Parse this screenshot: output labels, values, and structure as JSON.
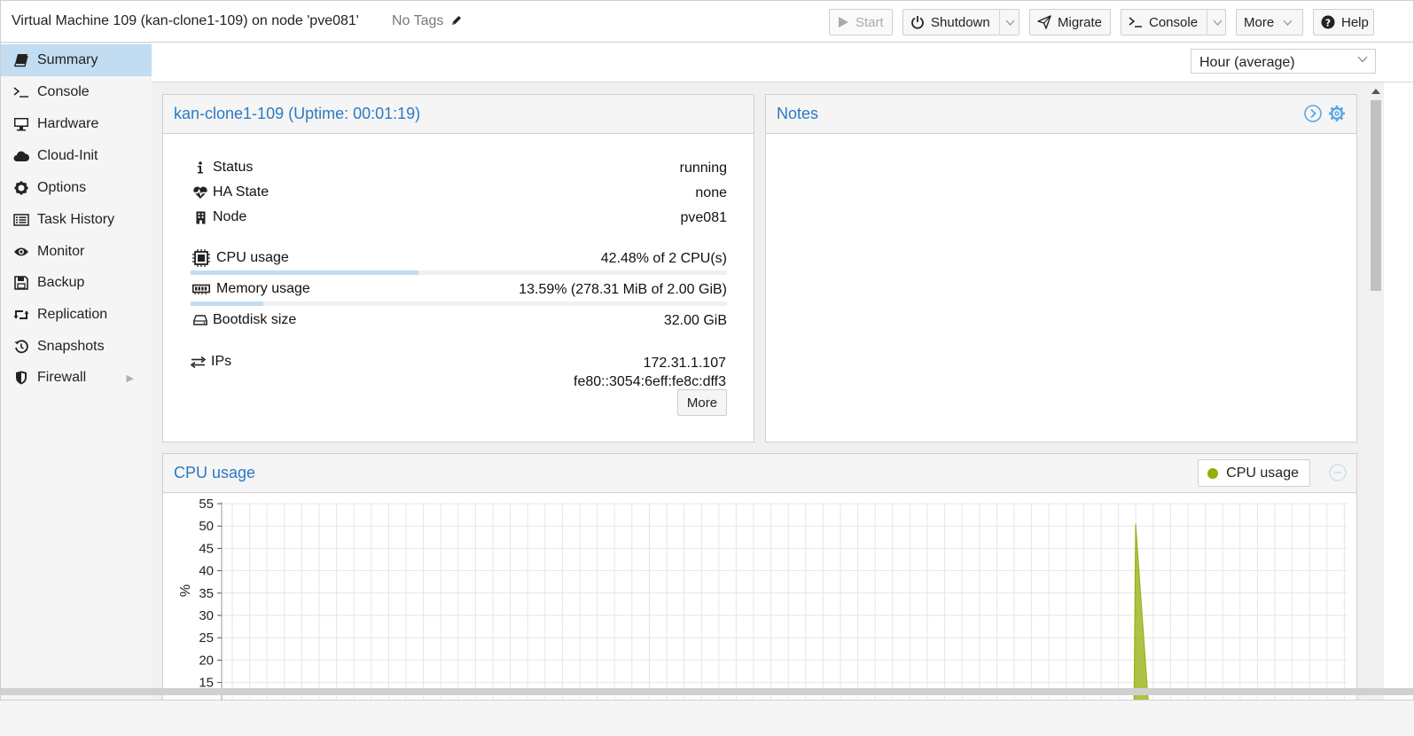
{
  "header": {
    "title": "Virtual Machine 109 (kan-clone1-109) on node 'pve081'",
    "tags": "No Tags",
    "buttons": {
      "start": "Start",
      "shutdown": "Shutdown",
      "migrate": "Migrate",
      "console": "Console",
      "more": "More",
      "help": "Help"
    }
  },
  "sidebar": {
    "items": [
      {
        "label": "Summary",
        "icon": "book-icon"
      },
      {
        "label": "Console",
        "icon": "terminal-icon"
      },
      {
        "label": "Hardware",
        "icon": "desktop-icon"
      },
      {
        "label": "Cloud-Init",
        "icon": "cloud-icon"
      },
      {
        "label": "Options",
        "icon": "gear-icon"
      },
      {
        "label": "Task History",
        "icon": "list-icon"
      },
      {
        "label": "Monitor",
        "icon": "eye-icon"
      },
      {
        "label": "Backup",
        "icon": "floppy-icon"
      },
      {
        "label": "Replication",
        "icon": "retweet-icon"
      },
      {
        "label": "Snapshots",
        "icon": "history-icon"
      },
      {
        "label": "Firewall",
        "icon": "shield-icon"
      }
    ]
  },
  "timeframe": {
    "selected": "Hour (average)"
  },
  "status_panel": {
    "title": "kan-clone1-109 (Uptime: 00:01:19)",
    "status": {
      "label": "Status",
      "value": "running"
    },
    "ha": {
      "label": "HA State",
      "value": "none"
    },
    "node": {
      "label": "Node",
      "value": "pve081"
    },
    "cpu": {
      "label": "CPU usage",
      "value": "42.48% of 2 CPU(s)",
      "fraction": 0.4248
    },
    "memory": {
      "label": "Memory usage",
      "value": "13.59% (278.31 MiB of 2.00 GiB)",
      "fraction": 0.1359
    },
    "bootdisk": {
      "label": "Bootdisk size",
      "value": "32.00 GiB"
    },
    "ips": {
      "label": "IPs",
      "ipv4": "172.31.1.107",
      "ipv6": "fe80::3054:6eff:fe8c:dff3"
    },
    "more_button": "More"
  },
  "notes_panel": {
    "title": "Notes"
  },
  "chart_panel": {
    "title": "CPU usage",
    "legend_label": "CPU usage",
    "ylabel": "%",
    "yticks": [
      "55",
      "50",
      "45",
      "40",
      "35",
      "30",
      "25",
      "20",
      "15"
    ]
  },
  "chart_data": {
    "type": "area",
    "ylabel": "%",
    "ylim": [
      15,
      55
    ],
    "grid": true,
    "series": [
      {
        "name": "CPU usage",
        "color": "#94ae0a",
        "points": [
          {
            "x": 0.8,
            "y": 50.5
          },
          {
            "x": 0.81,
            "y": 15
          }
        ]
      }
    ]
  },
  "colors": {
    "accent": "#2a7ac4",
    "selected": "#c2ddf2",
    "series": "#94ae0a"
  }
}
